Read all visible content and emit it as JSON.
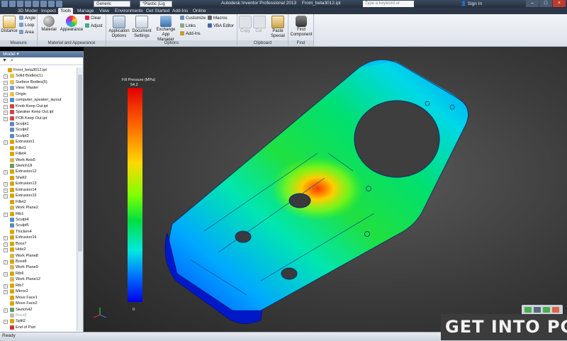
{
  "titlebar": {
    "combo_material": "Generic",
    "combo_appearance": "*Plastic (Lig",
    "app_title": "Autodesk Inventor Professional 2013",
    "document_title": "Front_beta3012.ipt",
    "search_placeholder": "Type a keyword or phrase",
    "signin_label": "Sign In",
    "min_label": "–",
    "max_label": "□",
    "close_label": "×"
  },
  "tabs": [
    "3D Model",
    "Inspect",
    "Tools",
    "Manage",
    "View",
    "Environments",
    "Get Started",
    "Add-Ins",
    "Online"
  ],
  "active_tab": "Tools",
  "ribbon": {
    "measure": {
      "title": "Measure",
      "distance": "Distance",
      "angle": "Angle",
      "loop": "Loop",
      "area": "Area"
    },
    "material_appearance": {
      "title": "Material and Appearance",
      "material": "Material",
      "appearance": "Appearance",
      "clear": "Clear",
      "adjust": "Adjust"
    },
    "options": {
      "title": "Options",
      "application_options": "Application Options",
      "document_settings": "Document Settings",
      "exchange_app_manager": "Exchange App Manager",
      "customize": "Customize",
      "links": "Links",
      "add_ins": "Add-Ins",
      "macros": "Macros",
      "vba_editor": "VBA Editor"
    },
    "clipboard": {
      "title": "Clipboard",
      "copy": "Copy",
      "cut": "Cut",
      "paste_special": "Paste Special"
    },
    "find": {
      "title": "Find",
      "find_component": "Find Component"
    }
  },
  "browser": {
    "header": "Model ▾",
    "filter_icon": "funnel",
    "find_icon": "binoculars",
    "items": [
      {
        "label": "Front_beta3012.ipt",
        "indent": 0,
        "icon": "part",
        "color": "#d8a200",
        "expander": ""
      },
      {
        "label": "Solid Bodies(1)",
        "indent": 1,
        "icon": "folder",
        "color": "#e6c24a",
        "expander": "+"
      },
      {
        "label": "Surface Bodies(6)",
        "indent": 1,
        "icon": "folder",
        "color": "#e6c24a",
        "expander": "+"
      },
      {
        "label": "View: Master",
        "indent": 1,
        "icon": "view",
        "color": "#7aa0c8",
        "expander": "+"
      },
      {
        "label": "Origin",
        "indent": 1,
        "icon": "folder",
        "color": "#e6c24a",
        "expander": "+"
      },
      {
        "label": "computer_speaker_layout",
        "indent": 1,
        "icon": "derived",
        "color": "#4a8fd0",
        "expander": "+"
      },
      {
        "label": "Knob Keep Out.ipt",
        "indent": 1,
        "icon": "part",
        "color": "#c44",
        "expander": "+"
      },
      {
        "label": "Speaker Keep Out.ipt",
        "indent": 1,
        "icon": "part",
        "color": "#c44",
        "expander": "+"
      },
      {
        "label": "PCB Keep Out.ipt",
        "indent": 1,
        "icon": "part",
        "color": "#c44",
        "expander": "+"
      },
      {
        "label": "Sculpt1",
        "indent": 1,
        "icon": "feature",
        "color": "#5a8bc0",
        "expander": ""
      },
      {
        "label": "Sculpt2",
        "indent": 1,
        "icon": "feature",
        "color": "#5a8bc0",
        "expander": ""
      },
      {
        "label": "Sculpt3",
        "indent": 1,
        "icon": "feature",
        "color": "#5a8bc0",
        "expander": ""
      },
      {
        "label": "Extrusion1",
        "indent": 1,
        "icon": "feature",
        "color": "#d9a400",
        "expander": "+"
      },
      {
        "label": "Fillet1",
        "indent": 1,
        "icon": "feature",
        "color": "#d9a400",
        "expander": ""
      },
      {
        "label": "Fillet4",
        "indent": 1,
        "icon": "feature",
        "color": "#d9a400",
        "expander": ""
      },
      {
        "label": "Work Axis5",
        "indent": 1,
        "icon": "work",
        "color": "#d9b54a",
        "expander": ""
      },
      {
        "label": "Sketch18",
        "indent": 1,
        "icon": "sketch",
        "color": "#6b9a5a",
        "expander": ""
      },
      {
        "label": "Extrusion12",
        "indent": 1,
        "icon": "feature",
        "color": "#d9a400",
        "expander": "+"
      },
      {
        "label": "Shell2",
        "indent": 1,
        "icon": "feature",
        "color": "#d9a400",
        "expander": ""
      },
      {
        "label": "Extrusion13",
        "indent": 1,
        "icon": "feature",
        "color": "#d9a400",
        "expander": "+"
      },
      {
        "label": "Extrusion14",
        "indent": 1,
        "icon": "feature",
        "color": "#d9a400",
        "expander": "+"
      },
      {
        "label": "Extrusion15",
        "indent": 1,
        "icon": "feature",
        "color": "#d9a400",
        "expander": "+"
      },
      {
        "label": "Fillet2",
        "indent": 1,
        "icon": "feature",
        "color": "#d9a400",
        "expander": ""
      },
      {
        "label": "Work Plane2",
        "indent": 1,
        "icon": "work",
        "color": "#d9b54a",
        "expander": ""
      },
      {
        "label": "Rib1",
        "indent": 1,
        "icon": "feature",
        "color": "#d9a400",
        "expander": "+"
      },
      {
        "label": "Sculpt4",
        "indent": 1,
        "icon": "feature",
        "color": "#5a8bc0",
        "expander": ""
      },
      {
        "label": "Sculpt5",
        "indent": 1,
        "icon": "feature",
        "color": "#5a8bc0",
        "expander": ""
      },
      {
        "label": "Thicken4",
        "indent": 1,
        "icon": "feature",
        "color": "#d9a400",
        "expander": ""
      },
      {
        "label": "Extrusion16",
        "indent": 1,
        "icon": "feature",
        "color": "#d9a400",
        "expander": "+"
      },
      {
        "label": "Boss7",
        "indent": 1,
        "icon": "feature",
        "color": "#d9a400",
        "expander": "+"
      },
      {
        "label": "Hole2",
        "indent": 1,
        "icon": "feature",
        "color": "#d9a400",
        "expander": "+"
      },
      {
        "label": "Work Plane8",
        "indent": 1,
        "icon": "work",
        "color": "#d9b54a",
        "expander": ""
      },
      {
        "label": "Boss8",
        "indent": 1,
        "icon": "feature",
        "color": "#d9a400",
        "expander": "+"
      },
      {
        "label": "Work Plane9",
        "indent": 1,
        "icon": "work",
        "color": "#d9b54a",
        "expander": ""
      },
      {
        "label": "Rib6",
        "indent": 1,
        "icon": "feature",
        "color": "#d9a400",
        "expander": "+"
      },
      {
        "label": "Work Plane12",
        "indent": 1,
        "icon": "work",
        "color": "#d9b54a",
        "expander": ""
      },
      {
        "label": "Rib7",
        "indent": 1,
        "icon": "feature",
        "color": "#d9a400",
        "expander": "+"
      },
      {
        "label": "Mirror2",
        "indent": 1,
        "icon": "feature",
        "color": "#d9a400",
        "expander": "+"
      },
      {
        "label": "Move Face1",
        "indent": 1,
        "icon": "feature",
        "color": "#d9a400",
        "expander": ""
      },
      {
        "label": "Move Face2",
        "indent": 1,
        "icon": "feature",
        "color": "#d9a400",
        "expander": ""
      },
      {
        "label": "Sketch42",
        "indent": 1,
        "icon": "sketch",
        "color": "#6b9a5a",
        "expander": "+"
      },
      {
        "label": "Boss8",
        "indent": 1,
        "icon": "feature",
        "color": "#bbb",
        "expander": "",
        "greyed": true
      },
      {
        "label": "Split2",
        "indent": 1,
        "icon": "feature",
        "color": "#d9a400",
        "expander": "+"
      },
      {
        "label": "End of Part",
        "indent": 1,
        "icon": "end",
        "color": "#c33",
        "expander": ""
      }
    ]
  },
  "viewport": {
    "legend_title": "Fill Pressure (MPa)",
    "legend_max": "54.2",
    "legend_min": "0",
    "colors": {
      "red": "#e30000",
      "orange": "#ff6a00",
      "yellow": "#ffd800",
      "green": "#00e040",
      "cyan": "#00e8e0",
      "blue": "#0000e8"
    }
  },
  "status": {
    "text": "Ready"
  },
  "watermark": {
    "text": "GET INTO PC"
  }
}
